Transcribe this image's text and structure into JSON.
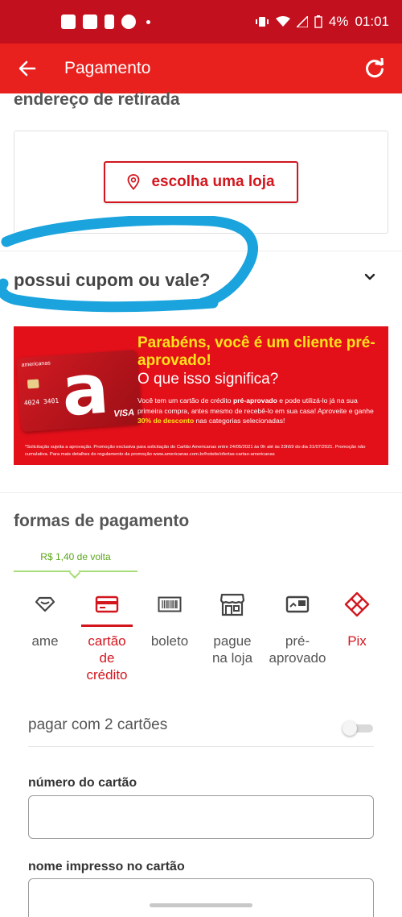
{
  "status_bar": {
    "battery": "4%",
    "time": "01:01"
  },
  "app_bar": {
    "title": "Pagamento"
  },
  "pickup": {
    "section_title": "endereço de retirada",
    "choose_store_label": "escolha uma loja"
  },
  "coupon": {
    "title": "possui cupom ou vale?"
  },
  "banner": {
    "card_brand": "americanas",
    "card_number": "4024 3401",
    "card_network": "VISA",
    "headline": "Parabéns, você é um cliente pré-aprovado!",
    "subheadline": "O que isso significa?",
    "body_1": "Você tem um cartão de crédito ",
    "body_bold": "pré-aprovado",
    "body_2": " e pode utilizá-lo já na sua primeira compra, antes mesmo de recebê-lo em sua casa! Aproveite e ganhe ",
    "body_highlight": "30% de desconto",
    "body_3": " nas categorias selecionadas!",
    "legal": "*Solicitação sujeita a aprovação. Promoção exclusiva para solicitação do Cartão Americanas entre 24/05/2021 às 0h até às 23h59 do dia 31/07/2021. Promoção não cumulativa. Para mais detalhes do regulamento da promoção www.americanas.com.br/hotsite/ofertas-cartao-americanas"
  },
  "payment": {
    "title": "formas de pagamento",
    "cashback": "R$ 1,40 de volta",
    "methods": [
      {
        "label": "ame",
        "icon": "ame-heart-icon"
      },
      {
        "label": "cartão de crédito",
        "icon": "credit-card-icon"
      },
      {
        "label": "boleto",
        "icon": "barcode-icon"
      },
      {
        "label": "pague na loja",
        "icon": "store-icon"
      },
      {
        "label": "pré-aprovado",
        "icon": "preapproved-card-icon"
      },
      {
        "label": "Pix",
        "icon": "pix-icon"
      }
    ],
    "active_method": "cartão de crédito",
    "accent_color": "#d3161e",
    "two_cards_label": "pagar com 2 cartões",
    "two_cards_enabled": false,
    "card_number_label": "número do cartão",
    "card_number_value": "",
    "printed_name_label": "nome impresso no cartão",
    "printed_name_value": ""
  },
  "colors": {
    "status_bar": "#c3101e",
    "app_bar": "#e8211e",
    "banner_bg": "#e3101a",
    "banner_headline": "#ffe21a",
    "cashback": "#5aa619",
    "annotation_scribble": "#1aa3dd"
  }
}
